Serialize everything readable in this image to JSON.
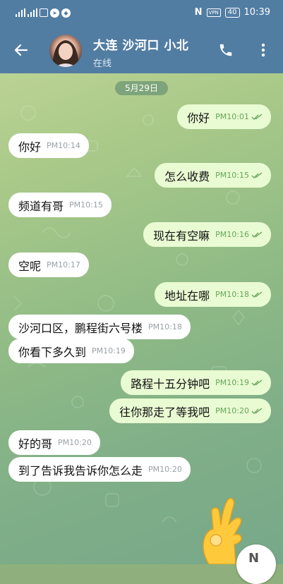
{
  "status_bar": {
    "signal_1_label": "5G",
    "signal_2_label": "4G",
    "time": "10:39",
    "battery": "40",
    "vpn": "VPN",
    "nfc": "N"
  },
  "header": {
    "back_icon": "arrow-left-icon",
    "title": "大连 沙河口 小北",
    "status": "在线",
    "call_icon": "phone-icon",
    "more_icon": "more-vertical-icon"
  },
  "date_label": "5月29日",
  "messages": [
    {
      "side": "out",
      "text": "你好",
      "time": "PM10:01"
    },
    {
      "side": "in",
      "text": "你好",
      "time": "PM10:14"
    },
    {
      "side": "out",
      "text": "怎么收费",
      "time": "PM10:15"
    },
    {
      "side": "in",
      "text": "频道有哥",
      "time": "PM10:15"
    },
    {
      "side": "out",
      "text": "现在有空嘛",
      "time": "PM10:16"
    },
    {
      "side": "in",
      "text": "空呢",
      "time": "PM10:17"
    },
    {
      "side": "out",
      "text": "地址在哪",
      "time": "PM10:18"
    },
    {
      "side": "in",
      "text": "沙河口区，鹏程街六号楼",
      "time": "PM10:18"
    },
    {
      "side": "in",
      "text": "你看下多久到",
      "time": "PM10:19"
    },
    {
      "side": "out",
      "text": "路程十五分钟吧",
      "time": "PM10:19"
    },
    {
      "side": "out",
      "text": "往你那走了等我吧",
      "time": "PM10:20"
    },
    {
      "side": "in",
      "text": "好的哥",
      "time": "PM10:20"
    },
    {
      "side": "in",
      "text": "到了告诉我告诉你怎么走",
      "time": "PM10:20"
    }
  ],
  "sticker": "ok-hand-emoji",
  "fab_label": "N",
  "colors": {
    "header": "#527da3",
    "outgoing_bubble": "#e9fbd2",
    "incoming_bubble": "#ffffff",
    "outgoing_time": "#66a55c"
  }
}
